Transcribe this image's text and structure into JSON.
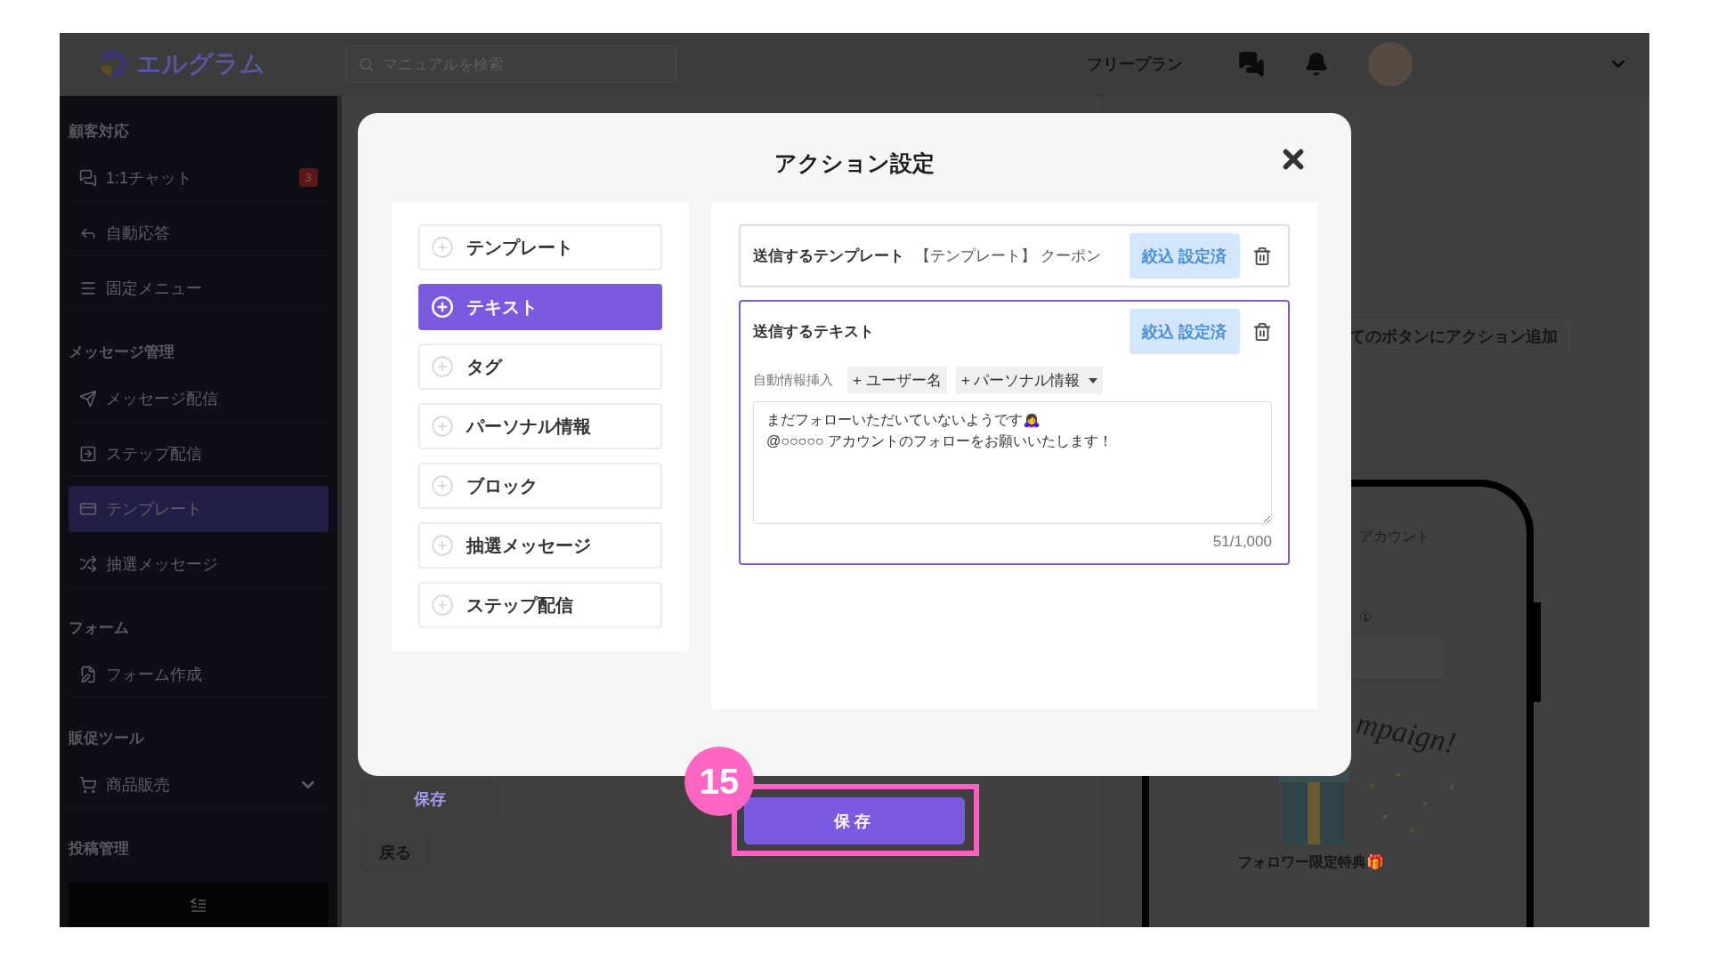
{
  "header": {
    "logo": "エルグラム",
    "search": {
      "placeholder": "マニュアルを検索"
    },
    "plan": "フリープラン"
  },
  "sidebar": {
    "sections": [
      {
        "heading": "顧客対応",
        "items": [
          {
            "label": "1:1チャット",
            "badge": "3",
            "selected": false,
            "kind": "link"
          },
          {
            "label": "自動応答",
            "selected": false,
            "kind": "link"
          },
          {
            "label": "固定メニュー",
            "selected": false,
            "kind": "link"
          }
        ]
      },
      {
        "heading": "メッセージ管理",
        "items": [
          {
            "label": "メッセージ配信",
            "selected": false,
            "kind": "link"
          },
          {
            "label": "ステップ配信",
            "selected": false,
            "kind": "link"
          },
          {
            "label": "テンプレート",
            "selected": true,
            "kind": "link"
          },
          {
            "label": "抽選メッセージ",
            "selected": false,
            "kind": "link"
          }
        ]
      },
      {
        "heading": "フォーム",
        "items": [
          {
            "label": "フォーム作成",
            "selected": false,
            "kind": "link"
          }
        ]
      },
      {
        "heading": "販促ツール",
        "items": [
          {
            "label": "商品販売",
            "selected": false,
            "kind": "menu"
          }
        ]
      },
      {
        "heading": "投稿管理"
      }
    ]
  },
  "page": {
    "save": "保存",
    "back": "戻る",
    "add_action": "てのボタンにアクション追加",
    "preview": {
      "account": "アカウント",
      "number": "①",
      "campaign": "mpaign!",
      "caption": "フォロワー限定特典🎁"
    }
  },
  "modal": {
    "title": "アクション設定",
    "actions": [
      {
        "label": "テンプレート",
        "selected": false
      },
      {
        "label": "テキスト",
        "selected": true
      },
      {
        "label": "タグ",
        "selected": false
      },
      {
        "label": "パーソナル情報",
        "selected": false
      },
      {
        "label": "ブロック",
        "selected": false
      },
      {
        "label": "抽選メッセージ",
        "selected": false
      },
      {
        "label": "ステップ配信",
        "selected": false
      }
    ],
    "cards": [
      {
        "kind": "template",
        "title": "送信するテンプレート",
        "value": "【テンプレート】 クーポン",
        "filter": "絞込 設定済",
        "selected": false
      },
      {
        "kind": "text",
        "title": "送信するテキスト",
        "filter": "絞込 設定済",
        "selected": true,
        "insert_label": "自動情報挿入",
        "insert_chips": [
          {
            "label": "+ ユーザー名",
            "kind": "button"
          },
          {
            "label": "+ パーソナル情報",
            "kind": "dropdown"
          }
        ],
        "message": "まだフォローいただいていないようです🙇‍♀️\n@○○○○○ アカウントのフォローをお願いいたします！",
        "counter": "51/1,000"
      }
    ]
  },
  "save_button": "保存",
  "step_badge": "15"
}
